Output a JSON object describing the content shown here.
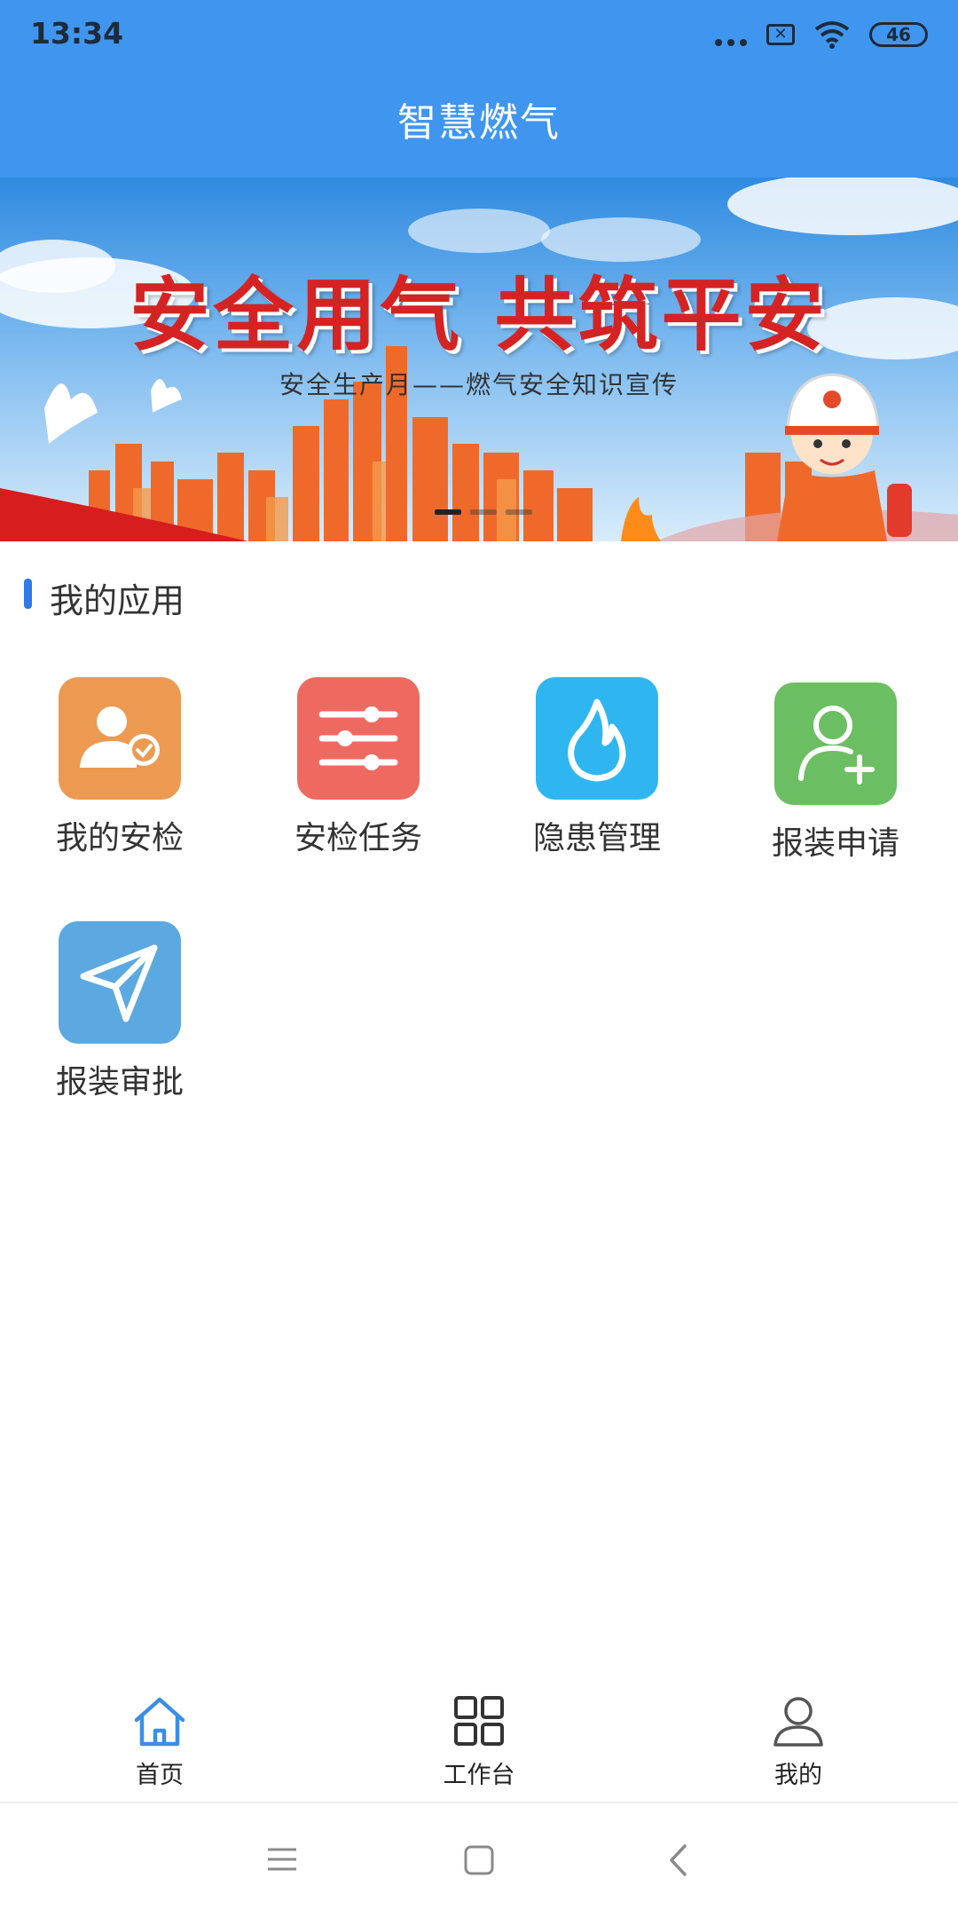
{
  "status_bar": {
    "time": "13:34",
    "signal_label": "46"
  },
  "header": {
    "title": "智慧燃气"
  },
  "banner": {
    "title": "安全用气 共筑平安",
    "subtitle": "安全生产月——燃气安全知识宣传",
    "pages": 3,
    "active_page": 1
  },
  "section": {
    "title": "我的应用"
  },
  "apps": [
    {
      "label": "我的安检",
      "icon": "user-check-icon",
      "color": "#EC9A52"
    },
    {
      "label": "安检任务",
      "icon": "sliders-icon",
      "color": "#EE6A60"
    },
    {
      "label": "隐患管理",
      "icon": "flame-icon",
      "color": "#2FB6F1"
    },
    {
      "label": "报装申请",
      "icon": "user-add-icon",
      "color": "#6CBE62"
    },
    {
      "label": "报装审批",
      "icon": "send-icon",
      "color": "#5BA9E0"
    }
  ],
  "bottom_nav": [
    {
      "label": "首页",
      "icon": "home-icon",
      "active": true
    },
    {
      "label": "工作台",
      "icon": "grid-icon",
      "active": false
    },
    {
      "label": "我的",
      "icon": "person-icon",
      "active": false
    }
  ],
  "colors": {
    "header": "#4096EE",
    "accent": "#2E7AE6"
  }
}
